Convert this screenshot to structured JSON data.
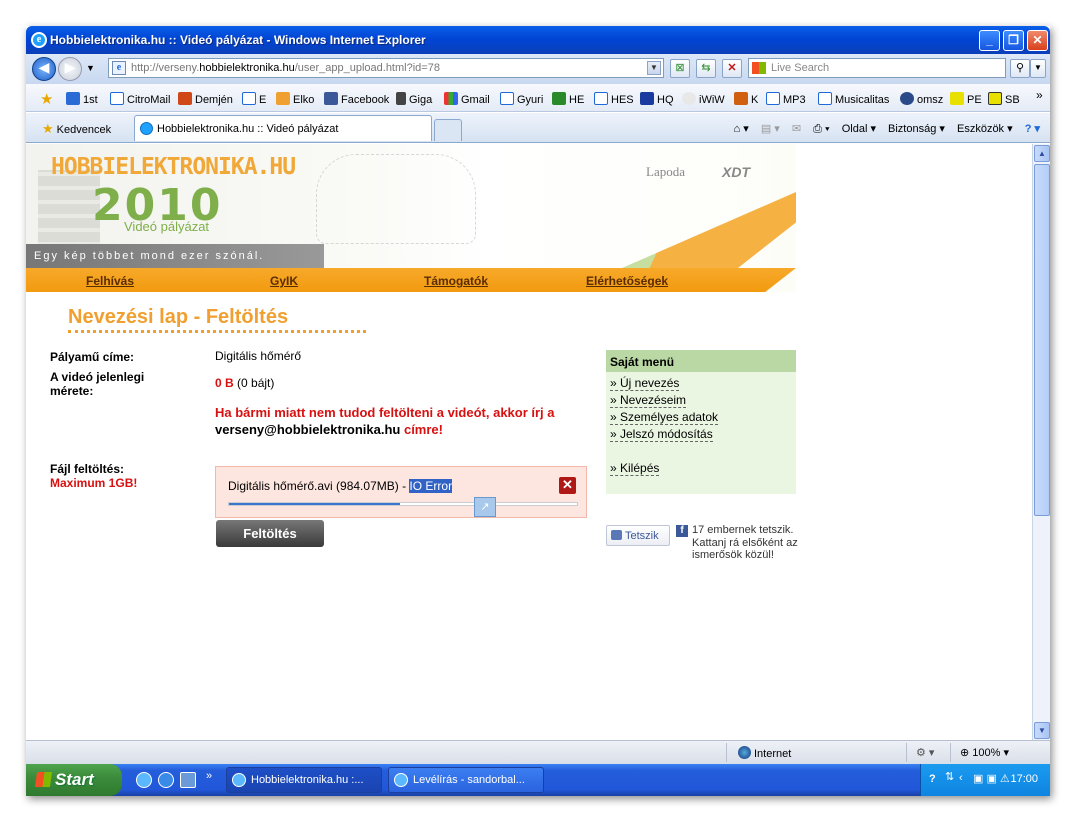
{
  "window": {
    "title": "Hobbielektronika.hu :: Videó pályázat - Windows Internet Explorer"
  },
  "address_bar": {
    "url_prefix": "http://verseny.",
    "url_domain": "hobbielektronika.hu",
    "url_suffix": "/user_app_upload.html?id=78",
    "search_placeholder": "Live Search"
  },
  "favorites_bar": {
    "items": [
      "1st",
      "CitroMail",
      "Demjén",
      "E",
      "Elko",
      "Facebook",
      "Giga",
      "Gmail",
      "Gyuri",
      "HE",
      "HES",
      "HQ",
      "iWiW",
      "K",
      "MP3",
      "Musicalitas",
      "omsz",
      "PE",
      "SB"
    ]
  },
  "tab_bar": {
    "favorites_label": "Kedvencek",
    "active_tab": "Hobbielektronika.hu :: Videó pályázat",
    "commands": [
      "Oldal ▾",
      "Biztonság ▾",
      "Eszközök ▾"
    ]
  },
  "banner": {
    "logo": "HOBBIELEKTRONIKA.HU",
    "year": "2010",
    "subtitle": "Videó pályázat",
    "motto": "Egy kép többet mond ezer szónál.",
    "sponsor1": "Lapoda",
    "sponsor2": "XDT"
  },
  "menu": {
    "items": [
      "Felhívás",
      "GyIK",
      "Támogatók",
      "Elérhetőségek"
    ]
  },
  "page": {
    "heading": "Nevezési lap - Feltöltés",
    "title_label": "Pályamű címe:",
    "title_value": "Digitális hőmérő",
    "size_label": "A videó jelenlegi mérete:",
    "size_bold": "0 B",
    "size_rest": "(0 bájt)",
    "warn_part1": "Ha bármi miatt nem tudod feltölteni a videót, akkor írj a",
    "warn_email": "verseny@hobbielektronika.hu",
    "warn_part2": "címre!",
    "upload_label": "Fájl feltöltés:",
    "upload_limit": "Maximum 1GB!",
    "upload_file": "Digitális hőmérő.avi (984.07MB) - ",
    "upload_error": "IO Error",
    "upload_progress": 0.49,
    "upload_button": "Feltöltés"
  },
  "sidebar": {
    "title": "Saját menü",
    "items": [
      "» Új nevezés",
      "» Nevezéseim",
      "» Személyes adatok",
      "» Jelszó módosítás",
      "» Kilépés"
    ],
    "like_button": "Tetszik",
    "like_line1": "17 embernek tetszik.",
    "like_line2": "Kattanj rá elsőként az ismerősök közül!"
  },
  "status_bar": {
    "zone": "Internet",
    "zoom": "100%"
  },
  "taskbar": {
    "start": "Start",
    "tasks": [
      "Hobbielektronika.hu :...",
      "Levélírás - sandorbal..."
    ],
    "clock": "17:00"
  },
  "colors": {
    "accent_orange": "#f29a10",
    "menu_green": "#b9d8a4",
    "warning_red": "#d81010"
  }
}
